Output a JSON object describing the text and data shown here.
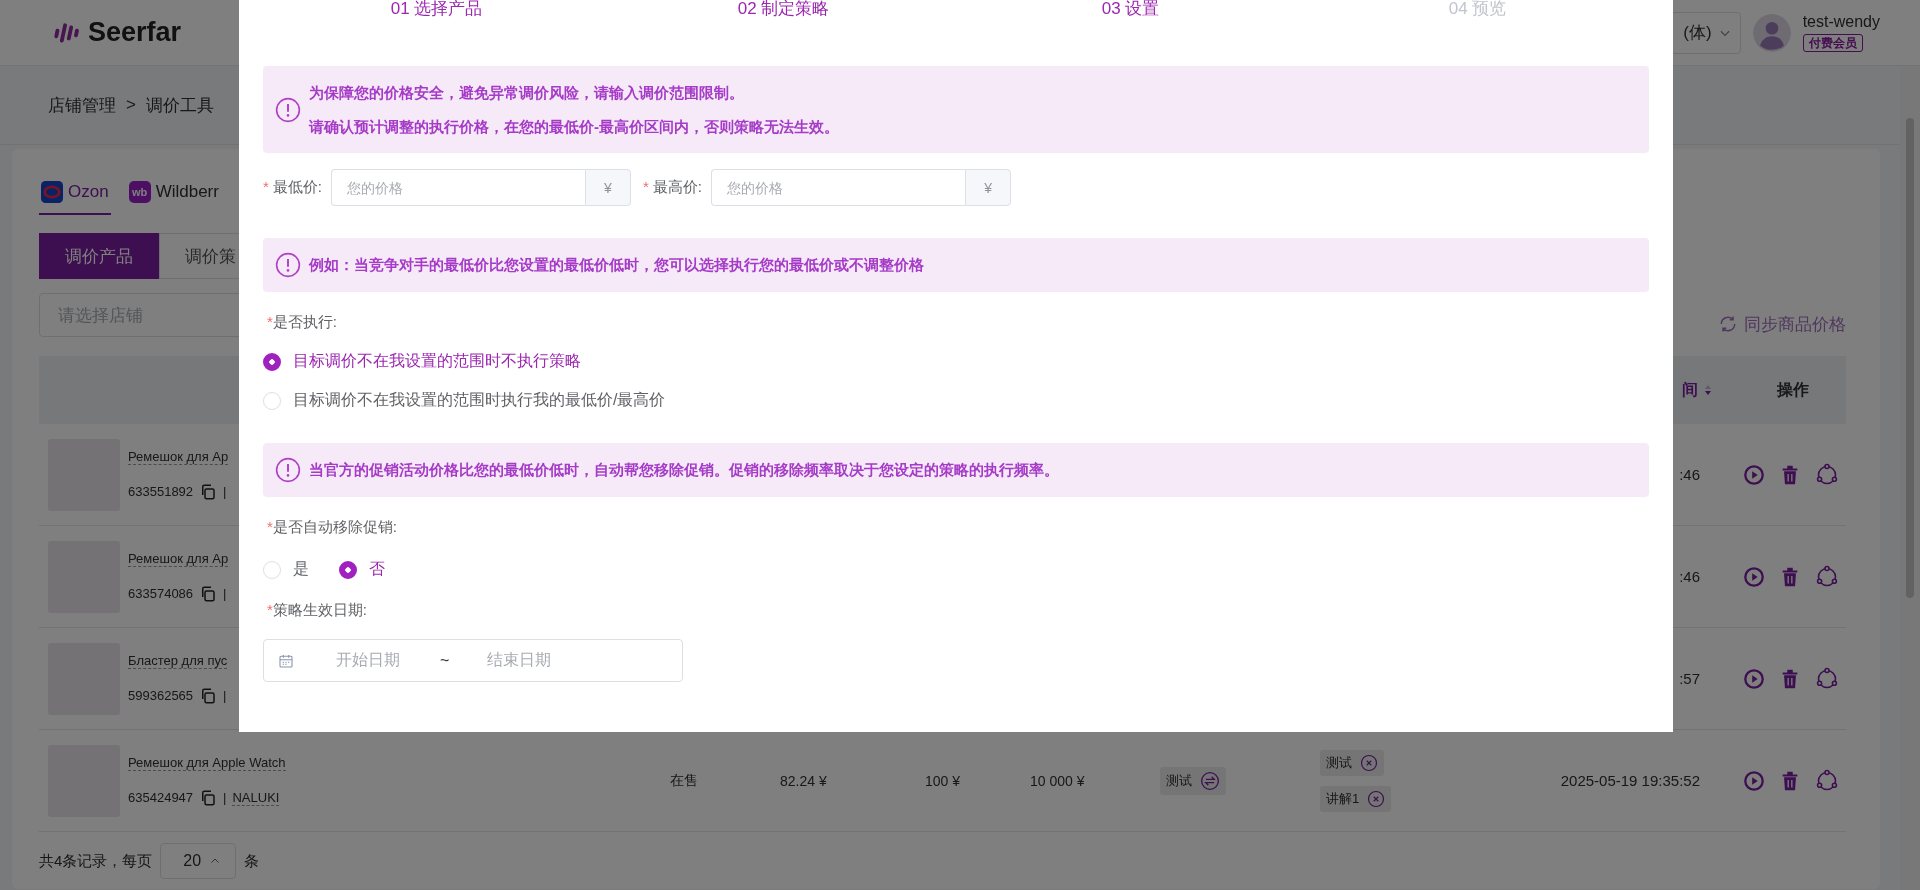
{
  "header": {
    "logo": "Seerfar",
    "language": "(体)",
    "user_name": "test-wendy",
    "member_badge": "付费会员"
  },
  "breadcrumb": {
    "items": [
      "店铺管理",
      "调价工具"
    ],
    "separator": ">"
  },
  "platform_tabs": [
    {
      "label": "Ozon",
      "selected": true,
      "kind": "ozon"
    },
    {
      "label": "Wildberr",
      "selected": false,
      "kind": "wb",
      "icon_text": "wb"
    }
  ],
  "sub_tabs": [
    {
      "label": "调价产品",
      "selected": true
    },
    {
      "label": "调价策",
      "selected": false
    }
  ],
  "store_select": {
    "placeholder": "请选择店铺"
  },
  "sync_button": {
    "label": "同步商品价格"
  },
  "table": {
    "time_header": {
      "label": "间",
      "sort_descending": true
    },
    "actions_header": "操作",
    "rows": [
      {
        "name": "Ремешок для Ap",
        "sku": "633551892",
        "divider": "|",
        "time": ":46"
      },
      {
        "name": "Ремешок для Ap",
        "sku": "633574086",
        "divider": "|",
        "time": ":46"
      },
      {
        "name": "Бластер для пус",
        "sku": "599362565",
        "divider": "|",
        "time": ":57"
      },
      {
        "name": "Ремешок для Apple Watch",
        "sku": "635424947",
        "divider": "|",
        "shop": "NALUKI",
        "status": "在售",
        "price": "82.24 ¥",
        "min_price": "100 ¥",
        "max_price": "10 000 ¥",
        "strategy": "测试",
        "tags": [
          "测试",
          "讲解1"
        ],
        "time": "2025-05-19 19:35:52"
      }
    ]
  },
  "pagination": {
    "summary": "共4条记录，每页",
    "page_size": "20",
    "suffix": "条"
  },
  "modal": {
    "steps": [
      {
        "label": "01 选择产品",
        "reached": true
      },
      {
        "label": "02 制定策略",
        "reached": true
      },
      {
        "label": "03 设置",
        "reached": true
      },
      {
        "label": "04 预览",
        "reached": false
      }
    ],
    "price_alert": {
      "lines": [
        "为保障您的价格安全，避免异常调价风险，请输入调价范围限制。",
        "请确认预计调整的执行价格，在您的最低价-最高价区间内，否则策略无法生效。"
      ]
    },
    "price_fields": [
      {
        "mark": "*",
        "label": "最低价:",
        "placeholder": "您的价格",
        "unit": "¥"
      },
      {
        "mark": "*",
        "label": "最高价:",
        "placeholder": "您的价格",
        "unit": "¥"
      }
    ],
    "execute_alert": {
      "lines": [
        "例如：当竞争对手的最低价比您设置的最低价低时，您可以选择执行您的最低价或不调整价格"
      ]
    },
    "execute": {
      "mark": "*",
      "label": "是否执行:",
      "options": [
        {
          "label": "目标调价不在我设置的范围时不执行策略",
          "selected": true
        },
        {
          "label": "目标调价不在我设置的范围时执行我的最低价/最高价",
          "selected": false
        }
      ]
    },
    "promo_alert": {
      "lines": [
        "当官方的促销活动价格比您的最低价低时，自动帮您移除促销。促销的移除频率取决于您设定的策略的执行频率。"
      ]
    },
    "remove_promo": {
      "mark": "*",
      "label": "是否自动移除促销:",
      "options": [
        {
          "label": "是",
          "selected": false
        },
        {
          "label": "否",
          "selected": true
        }
      ]
    },
    "effective_date": {
      "mark": "*",
      "label": "策略生效日期:",
      "start_placeholder": "开始日期",
      "separator": "~",
      "end_placeholder": "结束日期"
    }
  }
}
